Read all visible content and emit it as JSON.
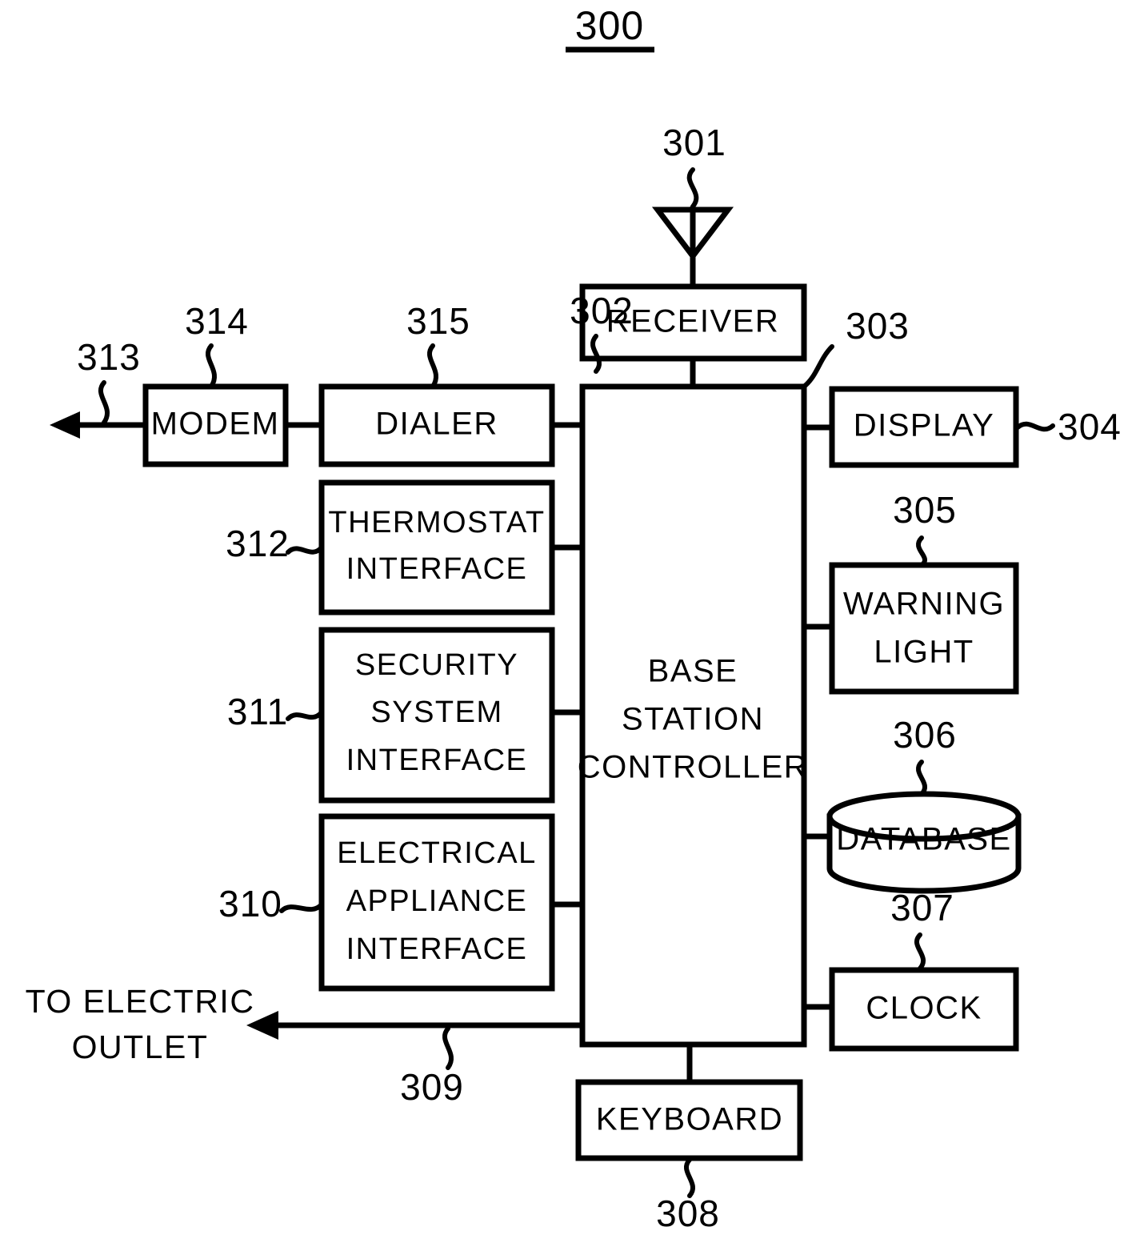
{
  "figure": {
    "title": "300",
    "type": "patent-block-diagram"
  },
  "blocks": {
    "receiver": {
      "label": "RECEIVER",
      "ref": "302"
    },
    "controller": {
      "line1": "BASE",
      "line2": "STATION",
      "line3": "CONTROLLER",
      "ref": "303"
    },
    "modem": {
      "label": "MODEM",
      "ref": "314"
    },
    "dialer": {
      "label": "DIALER",
      "ref": "315"
    },
    "thermostat": {
      "line1": "THERMOSTAT",
      "line2": "INTERFACE",
      "ref": "312"
    },
    "security": {
      "line1": "SECURITY",
      "line2": "SYSTEM",
      "line3": "INTERFACE",
      "ref": "311"
    },
    "appliance": {
      "line1": "ELECTRICAL",
      "line2": "APPLIANCE",
      "line3": "INTERFACE",
      "ref": "310"
    },
    "display": {
      "label": "DISPLAY",
      "ref": "304"
    },
    "warning": {
      "line1": "WARNING",
      "line2": "LIGHT",
      "ref": "305"
    },
    "database": {
      "label": "DATABASE",
      "ref": "306"
    },
    "clock": {
      "label": "CLOCK",
      "ref": "307"
    },
    "keyboard": {
      "label": "KEYBOARD",
      "ref": "308"
    }
  },
  "annotations": {
    "antenna_ref": "301",
    "phone_line_ref": "313",
    "outlet_ref": "309",
    "outlet_line1": "TO ELECTRIC",
    "outlet_line2": "OUTLET"
  },
  "colors": {
    "ink": "#000000",
    "paper": "#ffffff"
  }
}
